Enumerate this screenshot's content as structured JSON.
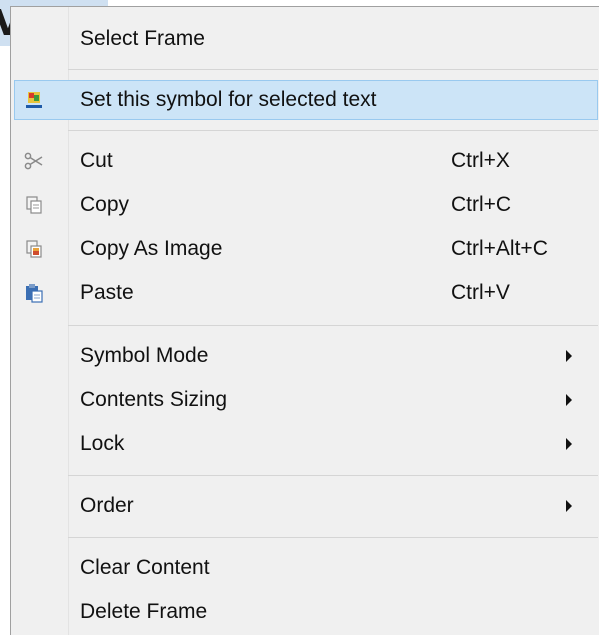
{
  "background": {
    "glyph": "V"
  },
  "menu": {
    "items": [
      {
        "label": "Select Frame",
        "shortcut": ""
      },
      {
        "label": "Set this symbol for selected text",
        "shortcut": "",
        "icon": "symbol-icon"
      },
      {
        "label": "Cut",
        "shortcut": "Ctrl+X",
        "icon": "scissors-icon"
      },
      {
        "label": "Copy",
        "shortcut": "Ctrl+C",
        "icon": "copy-icon"
      },
      {
        "label": "Copy As Image",
        "shortcut": "Ctrl+Alt+C",
        "icon": "copy-image-icon"
      },
      {
        "label": "Paste",
        "shortcut": "Ctrl+V",
        "icon": "paste-icon"
      },
      {
        "label": "Symbol Mode",
        "submenu": true
      },
      {
        "label": "Contents Sizing",
        "submenu": true
      },
      {
        "label": "Lock",
        "submenu": true
      },
      {
        "label": "Order",
        "submenu": true
      },
      {
        "label": "Clear Content",
        "shortcut": ""
      },
      {
        "label": "Delete Frame",
        "shortcut": ""
      }
    ]
  },
  "colors": {
    "menu_bg": "#f0f0f0",
    "highlight": "#cce4f7",
    "highlight_border": "#99c9ef"
  }
}
